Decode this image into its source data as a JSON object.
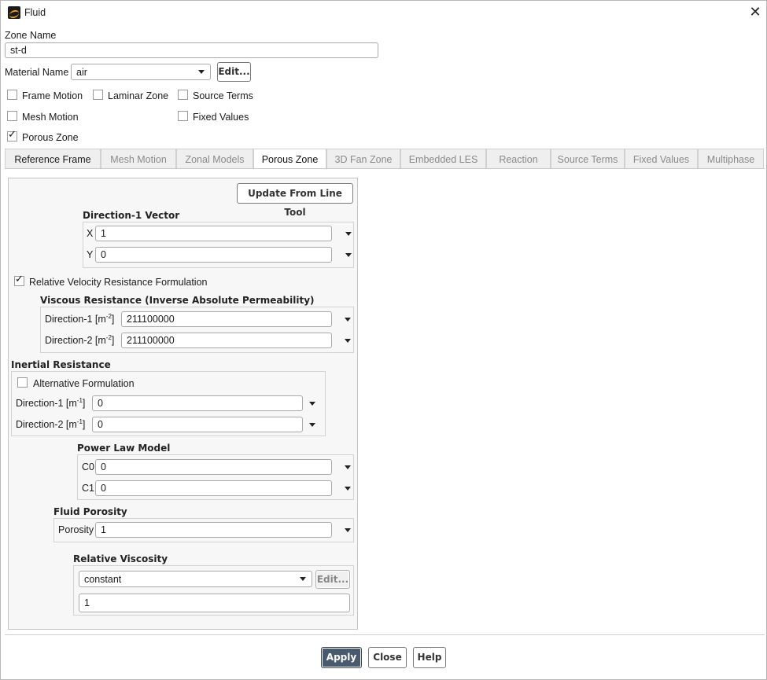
{
  "window": {
    "title": "Fluid",
    "close_glyph": "✕"
  },
  "zone_name": {
    "label": "Zone Name",
    "value": "st-d"
  },
  "material": {
    "label": "Material Name",
    "value": "air",
    "edit_label": "Edit..."
  },
  "options": {
    "frame_motion": {
      "label": "Frame Motion",
      "checked": false
    },
    "laminar_zone": {
      "label": "Laminar Zone",
      "checked": false
    },
    "source_terms": {
      "label": "Source Terms",
      "checked": false
    },
    "mesh_motion": {
      "label": "Mesh Motion",
      "checked": false
    },
    "fixed_values": {
      "label": "Fixed Values",
      "checked": false
    },
    "porous_zone": {
      "label": "Porous Zone",
      "checked": true
    }
  },
  "tabs": [
    {
      "label": "Reference Frame"
    },
    {
      "label": "Mesh Motion"
    },
    {
      "label": "Zonal Models"
    },
    {
      "label": "Porous Zone"
    },
    {
      "label": "3D Fan Zone"
    },
    {
      "label": "Embedded LES"
    },
    {
      "label": "Reaction"
    },
    {
      "label": "Source Terms"
    },
    {
      "label": "Fixed Values"
    },
    {
      "label": "Multiphase"
    }
  ],
  "active_tab": "Porous Zone",
  "porous": {
    "update_button": "Update From Line Tool",
    "direction1": {
      "title": "Direction-1 Vector",
      "x_label": "X",
      "x_value": "1",
      "y_label": "Y",
      "y_value": "0"
    },
    "relative_velocity": {
      "label": "Relative Velocity Resistance Formulation",
      "checked": true
    },
    "viscous": {
      "title": "Viscous Resistance (Inverse Absolute Permeability)",
      "d1_label": "Direction-1 [m",
      "d1_exp": "-2",
      "d1_value": "211100000",
      "d2_label": "Direction-2 [m",
      "d2_exp": "-2",
      "d2_value": "211100000",
      "bracket": "]"
    },
    "inertial": {
      "title": "Inertial Resistance",
      "alt_label": "Alternative Formulation",
      "alt_checked": false,
      "d1_label": "Direction-1 [m",
      "d1_exp": "-1",
      "d1_value": "0",
      "d2_label": "Direction-2 [m",
      "d2_exp": "-1",
      "d2_value": "0",
      "bracket": "]"
    },
    "power_law": {
      "title": "Power Law Model",
      "c0_label": "C0",
      "c0_value": "0",
      "c1_label": "C1",
      "c1_value": "0"
    },
    "porosity": {
      "title": "Fluid Porosity",
      "label": "Porosity",
      "value": "1"
    },
    "relative_viscosity": {
      "title": "Relative Viscosity",
      "method": "constant",
      "edit_label": "Edit...",
      "value": "1"
    }
  },
  "footer": {
    "apply": "Apply",
    "close": "Close",
    "help": "Help"
  },
  "colors": {
    "apply_bg": "#4a5a6e",
    "tab_inactive_text": "#8a8a8a"
  }
}
